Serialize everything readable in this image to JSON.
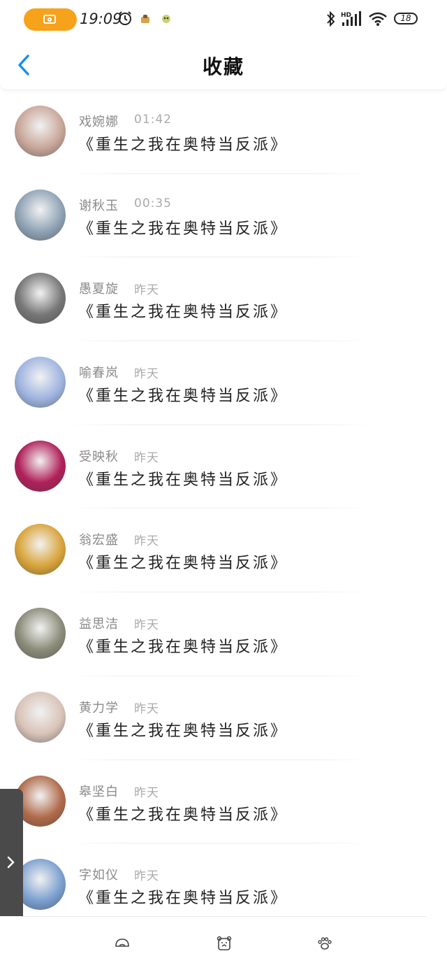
{
  "status_bar": {
    "time": "19:09",
    "battery": "18",
    "icons": [
      "camera-icon",
      "alarm-icon",
      "app-notification-icon",
      "app-notification-icon",
      "bluetooth-icon",
      "hd-signal-icon",
      "wifi-icon",
      "battery-icon"
    ]
  },
  "header": {
    "title": "收藏",
    "back_icon": "chevron-left-icon"
  },
  "items": [
    {
      "name": "戏婉娜",
      "time": "01:42",
      "book": "《重生之我在奥特当反派》",
      "avatar": "#c9a79a"
    },
    {
      "name": "谢秋玉",
      "time": "00:35",
      "book": "《重生之我在奥特当反派》",
      "avatar": "#8fa3b5"
    },
    {
      "name": "愚夏旋",
      "time": "昨天",
      "book": "《重生之我在奥特当反派》",
      "avatar": "#777777"
    },
    {
      "name": "喻春岚",
      "time": "昨天",
      "book": "《重生之我在奥特当反派》",
      "avatar": "#9fb4e0"
    },
    {
      "name": "受映秋",
      "time": "昨天",
      "book": "《重生之我在奥特当反派》",
      "avatar": "#b0205a"
    },
    {
      "name": "翁宏盛",
      "time": "昨天",
      "book": "《重生之我在奥特当反派》",
      "avatar": "#d9a43a"
    },
    {
      "name": "益思洁",
      "time": "昨天",
      "book": "《重生之我在奥特当反派》",
      "avatar": "#8c8c7a"
    },
    {
      "name": "黄力学",
      "time": "昨天",
      "book": "《重生之我在奥特当反派》",
      "avatar": "#d8c3b8"
    },
    {
      "name": "皋坚白",
      "time": "昨天",
      "book": "《重生之我在奥特当反派》",
      "avatar": "#b06a4a"
    },
    {
      "name": "字如仪",
      "time": "昨天",
      "book": "《重生之我在奥特当反派》",
      "avatar": "#7a9fd0"
    }
  ],
  "bottom_tabs": [
    "home-icon",
    "bear-icon",
    "paw-icon"
  ],
  "colors": {
    "accent": "#1a8fe8",
    "camera_pill": "#f7a21b",
    "side_handle": "#4a4a4a"
  }
}
